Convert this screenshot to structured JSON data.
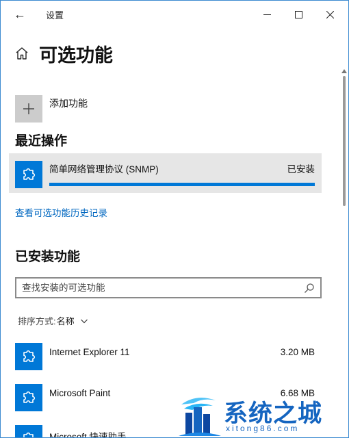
{
  "window": {
    "title": "设置",
    "back_glyph": "←"
  },
  "page": {
    "title": "可选功能",
    "add_label": "添加功能"
  },
  "recent": {
    "heading": "最近操作",
    "item": {
      "name": "简单网络管理协议 (SNMP)",
      "status": "已安装",
      "progress": 1.0
    },
    "history_link": "查看可选功能历史记录"
  },
  "installed": {
    "heading": "已安装功能",
    "search_placeholder": "查找安装的可选功能",
    "sort_label": "排序方式:",
    "sort_value": "名称",
    "items": [
      {
        "name": "Internet Explorer 11",
        "size": "3.20 MB"
      },
      {
        "name": "Microsoft Paint",
        "size": "6.68 MB"
      },
      {
        "name": "Microsoft 快速助手",
        "size": ""
      }
    ]
  },
  "watermark": {
    "name": "系统之城",
    "url": "xitong86.com"
  },
  "icons": {
    "back": "back-arrow-icon",
    "home": "home-icon",
    "add": "plus-icon",
    "feature": "puzzle-piece-icon",
    "search": "search-icon",
    "sort": "chevron-down-icon"
  },
  "colors": {
    "accent": "#0078d7",
    "link": "#0067c0",
    "tile_gray": "#cccccc",
    "card_bg": "#e6e6e6"
  }
}
